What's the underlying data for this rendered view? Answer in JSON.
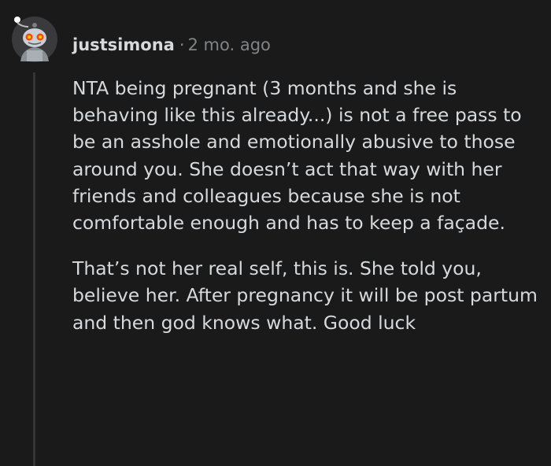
{
  "comment": {
    "author": "justsimona",
    "separator": "·",
    "timestamp": "2 mo. ago",
    "avatar_icon": "snoo-avatar-icon",
    "paragraphs": [
      "NTA being pregnant (3 months and she is behaving like this already...) is not a free pass to be an asshole and emotionally abusive to those around you. She doesn’t act that way with her friends and colleagues because she is not comfortable enough and has to keep a façade.",
      "That’s not her real self, this is. She told you, believe her. After pregnancy it will be post partum and then god knows what. Good luck"
    ]
  },
  "colors": {
    "background": "#1a1a1b",
    "text": "#d7dadc",
    "meta": "#818384",
    "thread_line": "#343536"
  }
}
